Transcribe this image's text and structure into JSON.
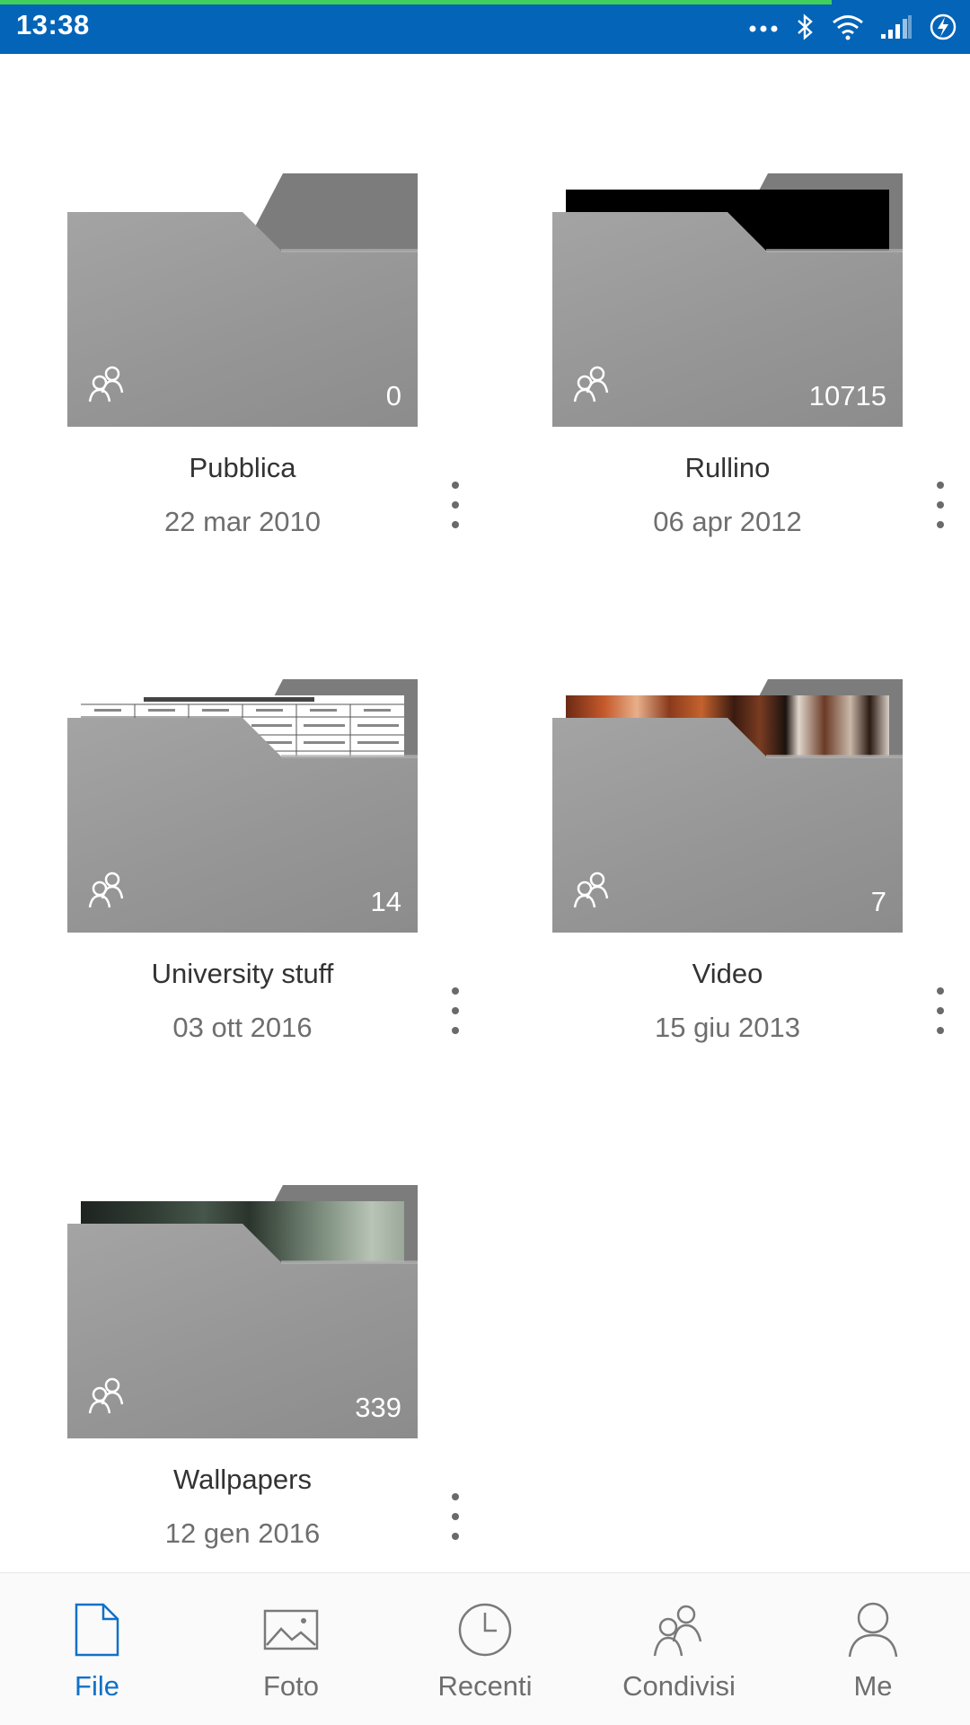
{
  "status_bar": {
    "time": "13:38",
    "icons": [
      "more-dots-icon",
      "bluetooth-icon",
      "wifi-icon",
      "signal-icon",
      "battery-charging-icon"
    ]
  },
  "colors": {
    "status_bar_bg": "#0364b8",
    "accent": "#1170c8",
    "folder_gray": "#9a9a9a"
  },
  "folders": [
    {
      "name": "Pubblica",
      "date": "22 mar 2010",
      "count": "0",
      "shared_icon": "shared-people-icon",
      "thumbnail": "none"
    },
    {
      "name": "Rullino",
      "date": "06 apr 2012",
      "count": "10715",
      "shared_icon": "shared-people-icon",
      "thumbnail": "black-photo"
    },
    {
      "name": "University stuff",
      "date": "03 ott 2016",
      "count": "14",
      "shared_icon": "shared-people-icon",
      "thumbnail": "document-table"
    },
    {
      "name": "Video",
      "date": "15 giu 2013",
      "count": "7",
      "shared_icon": "shared-people-icon",
      "thumbnail": "video-frame"
    },
    {
      "name": "Wallpapers",
      "date": "12 gen 2016",
      "count": "339",
      "shared_icon": "shared-people-icon",
      "thumbnail": "forest-photo"
    }
  ],
  "bottom_nav": {
    "items": [
      {
        "label": "File",
        "icon": "file-icon",
        "active": true
      },
      {
        "label": "Foto",
        "icon": "photo-icon",
        "active": false
      },
      {
        "label": "Recenti",
        "icon": "clock-icon",
        "active": false
      },
      {
        "label": "Condivisi",
        "icon": "shared-people-icon",
        "active": false
      },
      {
        "label": "Me",
        "icon": "person-icon",
        "active": false
      }
    ]
  }
}
